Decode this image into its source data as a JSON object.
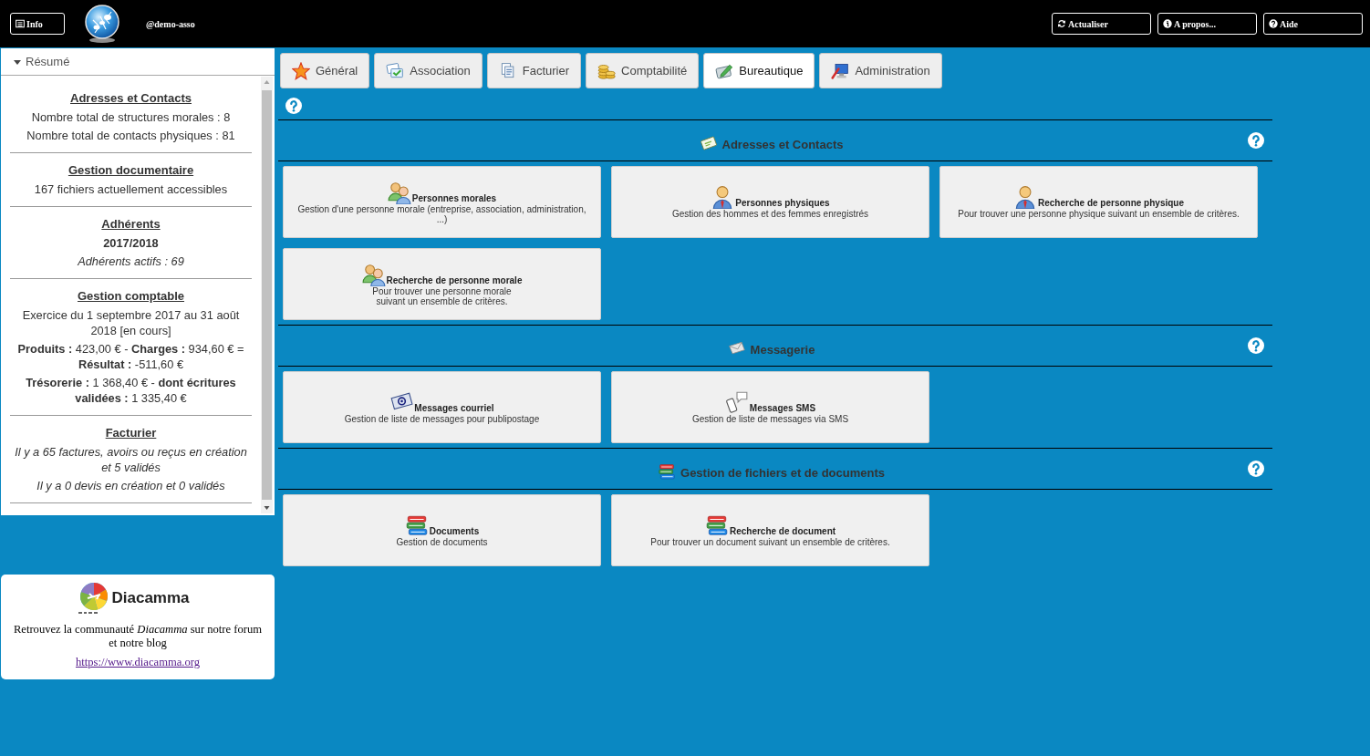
{
  "top_bar": {
    "left_buttons": [
      {
        "label": "Info",
        "kind": "list"
      }
    ],
    "account": "@demo-asso",
    "right_buttons": [
      {
        "label": "Actualiser",
        "kind": "refresh"
      },
      {
        "label": "A propos...",
        "kind": "info"
      },
      {
        "label": "Aide",
        "kind": "help"
      }
    ]
  },
  "summary": {
    "title": "Résumé",
    "expanded": true,
    "sections": [
      {
        "title": "Adresses et Contacts",
        "lines": [
          {
            "text": "Nombre total de structures morales : 8",
            "kind": "stat"
          },
          {
            "text": "Nombre total de contacts physiques : 81",
            "kind": "stat"
          }
        ]
      },
      {
        "title": "Gestion documentaire",
        "lines": [
          {
            "text": "167 fichiers actuellement accessibles",
            "kind": "stat"
          }
        ]
      },
      {
        "title": "Adhérents",
        "lines": [
          {
            "text": "2017/2018",
            "kind": "period"
          },
          {
            "text": "Adhérents actifs : 69",
            "kind": "note"
          }
        ]
      },
      {
        "title": "Gestion comptable",
        "lines": [
          {
            "text": "Exercice du 1 septembre 2017 au 31 août 2018 [en cours]",
            "kind": "stat"
          },
          {
            "text": "**Produits :** 423,00 € - **Charges :** 934,60 € = **Résultat :** -511,60 €",
            "kind": "stat"
          },
          {
            "text": "**Trésorerie :** 1 368,40 € - **dont écritures validées :** 1 335,40 €",
            "kind": "stat"
          }
        ]
      },
      {
        "title": "Facturier",
        "lines": [
          {
            "text": "Il y a 65 factures, avoirs ou reçus en création et 5 validés",
            "kind": "note"
          },
          {
            "text": "Il y a 0 devis en création et 0 validés",
            "kind": "note"
          }
        ]
      }
    ]
  },
  "tabs": [
    {
      "label": "Général",
      "kind": "star",
      "selected": false
    },
    {
      "label": "Association",
      "kind": "association",
      "selected": false
    },
    {
      "label": "Facturier",
      "kind": "invoice",
      "selected": false
    },
    {
      "label": "Comptabilité",
      "kind": "coins",
      "selected": false
    },
    {
      "label": "Bureautique",
      "kind": "office",
      "selected": true
    },
    {
      "label": "Administration",
      "kind": "admin",
      "selected": false
    }
  ],
  "sections": [
    {
      "title": "Adresses et Contacts",
      "kind": "contacts",
      "tiles": [
        {
          "title": "Personnes morales",
          "description": [
            "Gestion d'une personne morale (entreprise, association, administration, ...)"
          ],
          "kind": "group"
        },
        {
          "title": "Personnes physiques",
          "description": [
            "Gestion des hommes et des femmes enregistrés"
          ],
          "kind": "person"
        },
        {
          "title": "Recherche de personne physique",
          "description": [
            "Pour trouver une personne physique suivant un ensemble de critères."
          ],
          "kind": "person"
        },
        {
          "title": "Recherche de personne morale",
          "description": [
            "Pour trouver une personne morale",
            "suivant un ensemble de critères."
          ],
          "kind": "group"
        }
      ]
    },
    {
      "title": "Messagerie",
      "kind": "mail",
      "tiles": [
        {
          "title": "Messages courriel",
          "description": [
            "Gestion de liste de messages pour publipostage"
          ],
          "kind": "email"
        },
        {
          "title": "Messages SMS",
          "description": [
            "Gestion de liste de messages via SMS"
          ],
          "kind": "sms"
        }
      ]
    },
    {
      "title": "Gestion de fichiers et de documents",
      "kind": "books",
      "tiles": [
        {
          "title": "Documents",
          "description": [
            "Gestion de documents"
          ],
          "kind": "books"
        },
        {
          "title": "Recherche de document",
          "description": [
            "Pour trouver un document suivant un ensemble de critères."
          ],
          "kind": "books"
        }
      ]
    }
  ],
  "community": {
    "brand": "Diacamma",
    "text": "Retrouvez la communauté *Diacamma* sur notre forum et notre blog",
    "link": "https://www.diacamma.org"
  }
}
